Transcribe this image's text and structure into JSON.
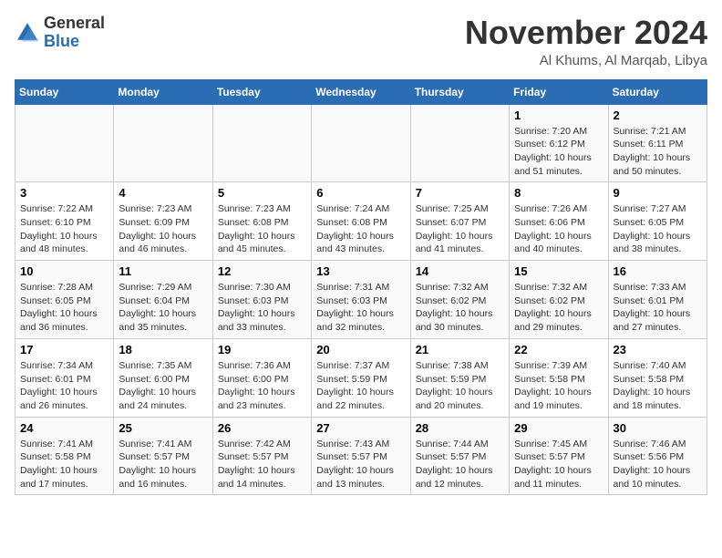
{
  "header": {
    "logo_general": "General",
    "logo_blue": "Blue",
    "month_year": "November 2024",
    "location": "Al Khums, Al Marqab, Libya"
  },
  "weekdays": [
    "Sunday",
    "Monday",
    "Tuesday",
    "Wednesday",
    "Thursday",
    "Friday",
    "Saturday"
  ],
  "weeks": [
    [
      {
        "day": "",
        "content": ""
      },
      {
        "day": "",
        "content": ""
      },
      {
        "day": "",
        "content": ""
      },
      {
        "day": "",
        "content": ""
      },
      {
        "day": "",
        "content": ""
      },
      {
        "day": "1",
        "content": "Sunrise: 7:20 AM\nSunset: 6:12 PM\nDaylight: 10 hours and 51 minutes."
      },
      {
        "day": "2",
        "content": "Sunrise: 7:21 AM\nSunset: 6:11 PM\nDaylight: 10 hours and 50 minutes."
      }
    ],
    [
      {
        "day": "3",
        "content": "Sunrise: 7:22 AM\nSunset: 6:10 PM\nDaylight: 10 hours and 48 minutes."
      },
      {
        "day": "4",
        "content": "Sunrise: 7:23 AM\nSunset: 6:09 PM\nDaylight: 10 hours and 46 minutes."
      },
      {
        "day": "5",
        "content": "Sunrise: 7:23 AM\nSunset: 6:08 PM\nDaylight: 10 hours and 45 minutes."
      },
      {
        "day": "6",
        "content": "Sunrise: 7:24 AM\nSunset: 6:08 PM\nDaylight: 10 hours and 43 minutes."
      },
      {
        "day": "7",
        "content": "Sunrise: 7:25 AM\nSunset: 6:07 PM\nDaylight: 10 hours and 41 minutes."
      },
      {
        "day": "8",
        "content": "Sunrise: 7:26 AM\nSunset: 6:06 PM\nDaylight: 10 hours and 40 minutes."
      },
      {
        "day": "9",
        "content": "Sunrise: 7:27 AM\nSunset: 6:05 PM\nDaylight: 10 hours and 38 minutes."
      }
    ],
    [
      {
        "day": "10",
        "content": "Sunrise: 7:28 AM\nSunset: 6:05 PM\nDaylight: 10 hours and 36 minutes."
      },
      {
        "day": "11",
        "content": "Sunrise: 7:29 AM\nSunset: 6:04 PM\nDaylight: 10 hours and 35 minutes."
      },
      {
        "day": "12",
        "content": "Sunrise: 7:30 AM\nSunset: 6:03 PM\nDaylight: 10 hours and 33 minutes."
      },
      {
        "day": "13",
        "content": "Sunrise: 7:31 AM\nSunset: 6:03 PM\nDaylight: 10 hours and 32 minutes."
      },
      {
        "day": "14",
        "content": "Sunrise: 7:32 AM\nSunset: 6:02 PM\nDaylight: 10 hours and 30 minutes."
      },
      {
        "day": "15",
        "content": "Sunrise: 7:32 AM\nSunset: 6:02 PM\nDaylight: 10 hours and 29 minutes."
      },
      {
        "day": "16",
        "content": "Sunrise: 7:33 AM\nSunset: 6:01 PM\nDaylight: 10 hours and 27 minutes."
      }
    ],
    [
      {
        "day": "17",
        "content": "Sunrise: 7:34 AM\nSunset: 6:01 PM\nDaylight: 10 hours and 26 minutes."
      },
      {
        "day": "18",
        "content": "Sunrise: 7:35 AM\nSunset: 6:00 PM\nDaylight: 10 hours and 24 minutes."
      },
      {
        "day": "19",
        "content": "Sunrise: 7:36 AM\nSunset: 6:00 PM\nDaylight: 10 hours and 23 minutes."
      },
      {
        "day": "20",
        "content": "Sunrise: 7:37 AM\nSunset: 5:59 PM\nDaylight: 10 hours and 22 minutes."
      },
      {
        "day": "21",
        "content": "Sunrise: 7:38 AM\nSunset: 5:59 PM\nDaylight: 10 hours and 20 minutes."
      },
      {
        "day": "22",
        "content": "Sunrise: 7:39 AM\nSunset: 5:58 PM\nDaylight: 10 hours and 19 minutes."
      },
      {
        "day": "23",
        "content": "Sunrise: 7:40 AM\nSunset: 5:58 PM\nDaylight: 10 hours and 18 minutes."
      }
    ],
    [
      {
        "day": "24",
        "content": "Sunrise: 7:41 AM\nSunset: 5:58 PM\nDaylight: 10 hours and 17 minutes."
      },
      {
        "day": "25",
        "content": "Sunrise: 7:41 AM\nSunset: 5:57 PM\nDaylight: 10 hours and 16 minutes."
      },
      {
        "day": "26",
        "content": "Sunrise: 7:42 AM\nSunset: 5:57 PM\nDaylight: 10 hours and 14 minutes."
      },
      {
        "day": "27",
        "content": "Sunrise: 7:43 AM\nSunset: 5:57 PM\nDaylight: 10 hours and 13 minutes."
      },
      {
        "day": "28",
        "content": "Sunrise: 7:44 AM\nSunset: 5:57 PM\nDaylight: 10 hours and 12 minutes."
      },
      {
        "day": "29",
        "content": "Sunrise: 7:45 AM\nSunset: 5:57 PM\nDaylight: 10 hours and 11 minutes."
      },
      {
        "day": "30",
        "content": "Sunrise: 7:46 AM\nSunset: 5:56 PM\nDaylight: 10 hours and 10 minutes."
      }
    ]
  ]
}
